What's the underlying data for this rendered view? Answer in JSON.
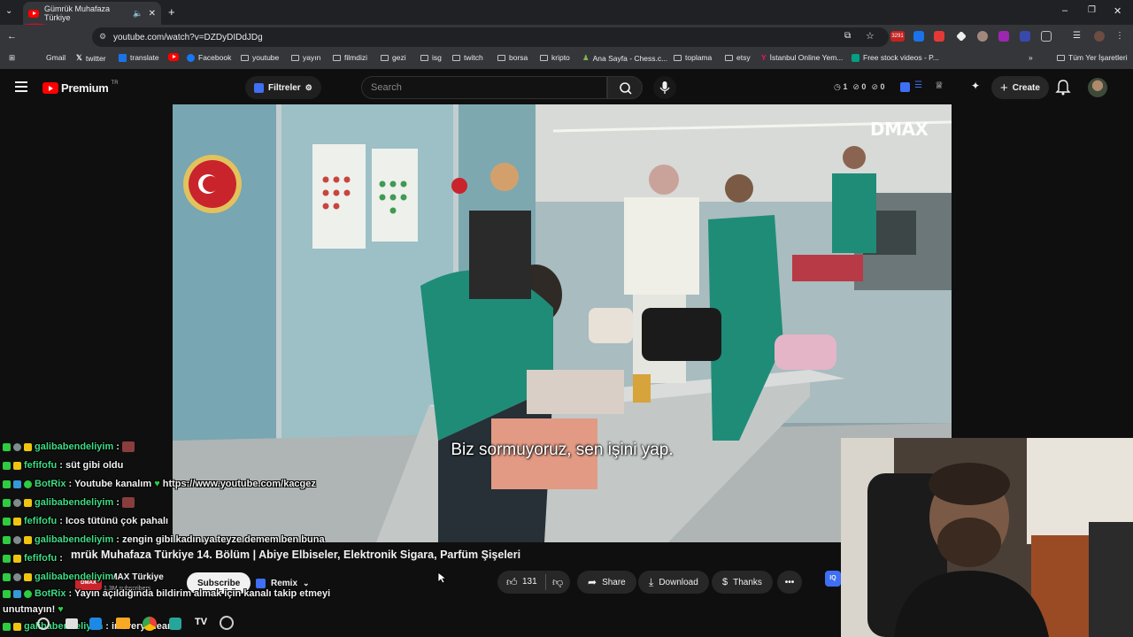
{
  "browser": {
    "tab_title": "Gümrük Muhafaza Türkiye",
    "url": "youtube.com/watch?v=DZDyDIDdJDg",
    "notification_count": "3291",
    "bookmarks": [
      {
        "label": "Gmail"
      },
      {
        "label": "twitter"
      },
      {
        "label": "translate"
      },
      {
        "label": "Facebook"
      },
      {
        "label": "youtube"
      },
      {
        "label": "yayın"
      },
      {
        "label": "filmdizi"
      },
      {
        "label": "gezi"
      },
      {
        "label": "isg"
      },
      {
        "label": "twitch"
      },
      {
        "label": "borsa"
      },
      {
        "label": "kripto"
      },
      {
        "label": "Ana Sayfa - Chess.c..."
      },
      {
        "label": "toplama"
      },
      {
        "label": "etsy"
      },
      {
        "label": "İstanbul Online Yem..."
      },
      {
        "label": "Free stock videos - P..."
      }
    ],
    "all_bookmarks": "Tüm Yer İşaretleri"
  },
  "youtube": {
    "logo_text": "Premium",
    "logo_sup": "TR",
    "filter_label": "Filtreler",
    "search_placeholder": "Search",
    "stats": {
      "a": "1",
      "b": "0",
      "c": "0"
    },
    "create_label": "Create"
  },
  "video": {
    "watermark": "DMAX",
    "subtitle": "Biz sormuyoruz, sen işini yap.",
    "title": "mrük Muhafaza Türkiye 14. Bölüm | Abiye Elbiseler, Elektronik Sigara, Parfüm Şişeleri",
    "channel": "DMAX Türkiye",
    "subscribers": "1,3M subscribers",
    "subscribe_label": "Subscribe",
    "remix_label": "Remix",
    "likes": "131",
    "share_label": "Share",
    "download_label": "Download",
    "thanks_label": "Thanks"
  },
  "chat": [
    {
      "user": "galibabendeliyim",
      "msg": ":",
      "color": "green"
    },
    {
      "user": "fefifofu",
      "msg": ": süt gibi oldu",
      "color": "green"
    },
    {
      "user": "BotRix",
      "msg": ": Youtube kanalım",
      "link": "https://www.youtube.com/kacgez",
      "color": "green"
    },
    {
      "user": "galibabendeliyim",
      "msg": ":",
      "color": "green"
    },
    {
      "user": "fefifofu",
      "msg": ": Icos tütünü çok pahalı",
      "color": "green"
    },
    {
      "user": "galibabendeliyim",
      "msg": ": zengin gibi kadın ya teyze demem ben buna",
      "color": "green"
    },
    {
      "user": "fefifofu",
      "msg": ":",
      "color": "green"
    },
    {
      "user": "galibabendeliyim",
      "msg": "",
      "color": "green"
    },
    {
      "user": "BotRix",
      "msg": ": Yayın açıldığında bildirim almak için kanalı takip etmeyi",
      "color": "green"
    },
    {
      "user": "",
      "msg": "unutmayın!",
      "color": "green"
    },
    {
      "user": "galibabendeliyim",
      "msg": ": im very clean",
      "color": "green"
    }
  ],
  "colors": {
    "accent": "#ff0000",
    "chat_user": "#3ddc84",
    "background": "#0f0f0f"
  }
}
